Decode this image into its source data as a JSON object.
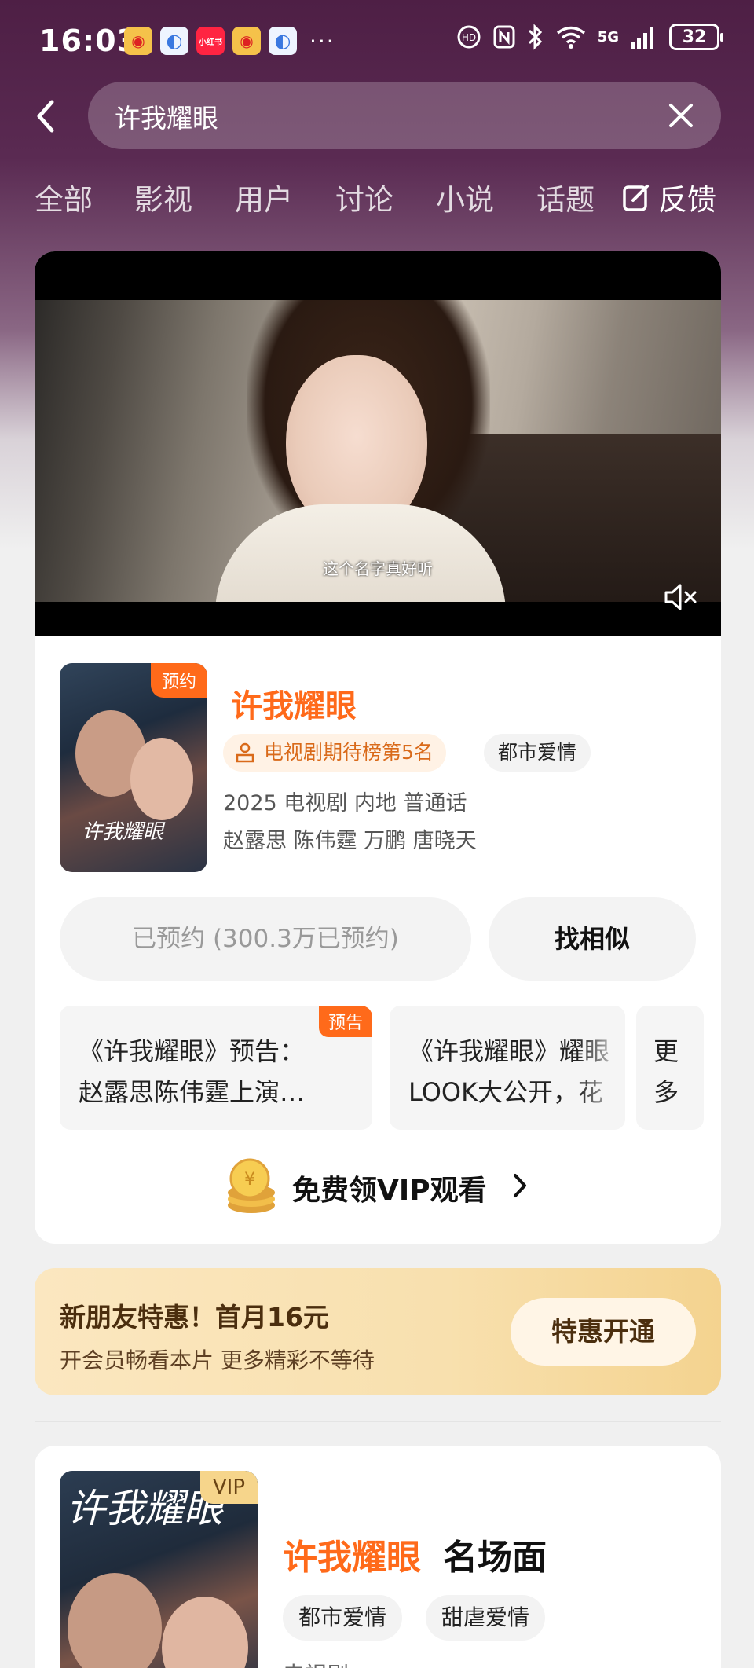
{
  "status_bar": {
    "time": "16:03",
    "app_icons": [
      {
        "name": "weibo-icon",
        "glyph": "◉"
      },
      {
        "name": "browser-icon",
        "glyph": "◐"
      },
      {
        "name": "xiaohongshu-icon",
        "glyph": "小红书"
      },
      {
        "name": "weibo-icon",
        "glyph": "◉"
      },
      {
        "name": "browser-icon",
        "glyph": "◐"
      }
    ],
    "more": "···",
    "network": "5G",
    "battery": "32"
  },
  "search": {
    "query": "许我耀眼"
  },
  "tabs": [
    "全部",
    "影视",
    "用户",
    "讨论",
    "小说",
    "话题"
  ],
  "feedback_label": "反馈",
  "video": {
    "subtitle": "这个名字真好听"
  },
  "show": {
    "reserve_badge": "预约",
    "poster_title": "许我耀眼",
    "title": "许我耀眼",
    "rank_tag": "电视剧期待榜第5名",
    "genre_tag": "都市爱情",
    "meta": "2025 电视剧 内地 普通话",
    "cast": "赵露思 陈伟霆 万鹏 唐晓天"
  },
  "buttons": {
    "reserved": "已预约 (300.3万已预约)",
    "similar": "找相似"
  },
  "clips": [
    {
      "badge": "预告",
      "line1": "《许我耀眼》预告：",
      "line2": "赵露思陈伟霆上演…"
    },
    {
      "badge": "",
      "line1": "《许我耀眼》耀眼",
      "line2": "LOOK大公开，花"
    }
  ],
  "clips_more": "更多",
  "vip_link": "免费领VIP观看",
  "promo": {
    "title": "新朋友特惠！首月16元",
    "subtitle": "开会员畅看本片 更多精彩不等待",
    "button": "特惠开通"
  },
  "card2": {
    "badge": "VIP",
    "poster_title": "许我耀眼",
    "title": "许我耀眼",
    "scene": "名场面",
    "tags": [
      "都市爱情",
      "甜虐爱情"
    ],
    "type": "电视剧"
  },
  "colors": {
    "accent": "#ff6a1a",
    "header_bg": "#4e1f45",
    "promo_bg": "#f8e0ae"
  }
}
